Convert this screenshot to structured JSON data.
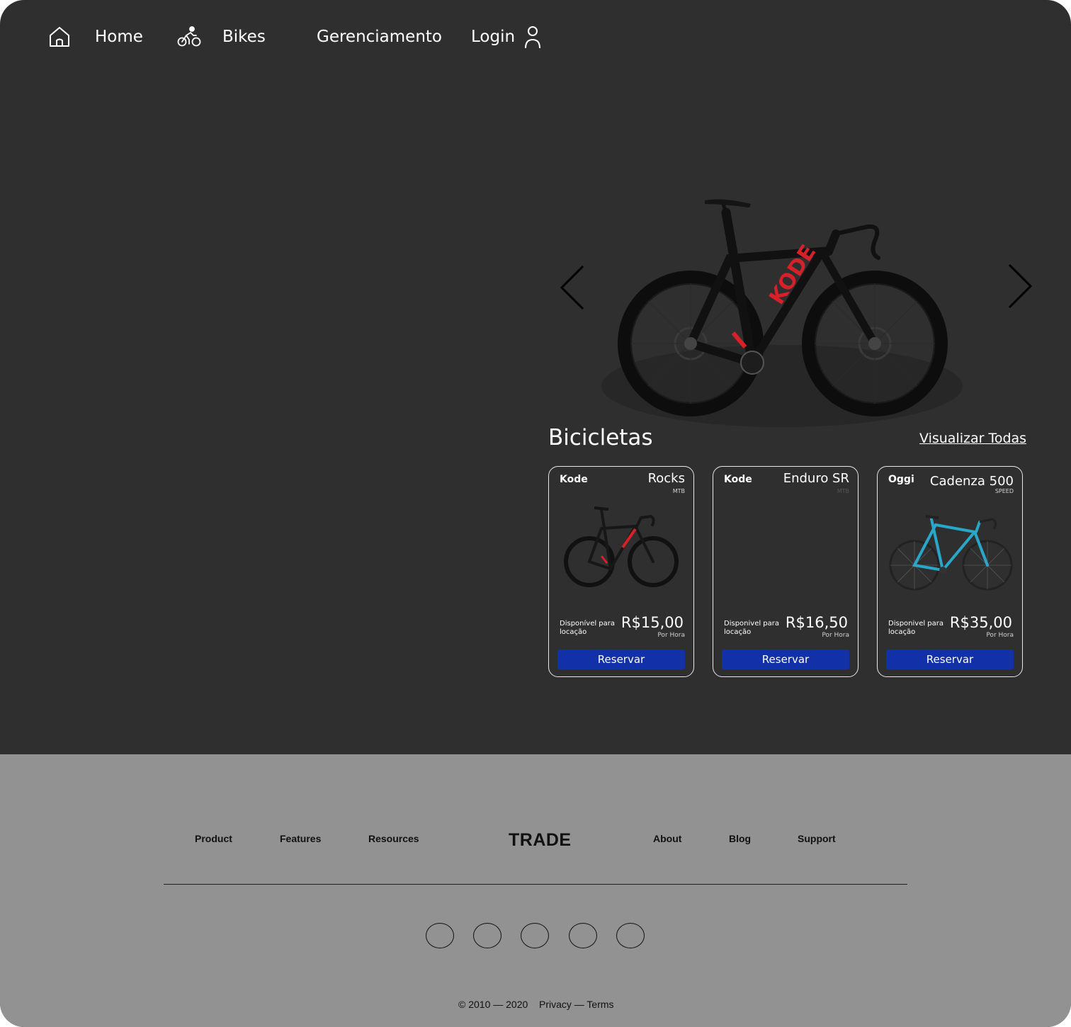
{
  "nav": {
    "home_label": "Home",
    "bikes_label": "Bikes",
    "manage_label": "Gerenciamento",
    "login_label": "Login",
    "icons": [
      "home-icon",
      "cyclist-icon",
      "user-icon"
    ]
  },
  "hero": {
    "bike_brand_text": "KODE",
    "accent_color": "#d6202a"
  },
  "section": {
    "title": "Bicicletas",
    "view_all": "Visualizar Todas"
  },
  "cards": [
    {
      "brand": "Kode",
      "model": "Rocks",
      "type": "MTB",
      "availability": "Disponível para locação",
      "price": "R$15,00",
      "per": "Por Hora",
      "button": "Reservar",
      "frame_color": "#1b1b1b"
    },
    {
      "brand": "Kode",
      "model": "Enduro SR",
      "type": "MTB",
      "availability": "Disponivel para locação",
      "price": "R$16,50",
      "per": "Por Hora",
      "button": "Reservar"
    },
    {
      "brand": "Oggi",
      "model": "Cadenza 500",
      "type": "SPEED",
      "availability": "Disponivel para locação",
      "price": "R$35,00",
      "per": "Por Hora",
      "button": "Reservar",
      "frame_color": "#29a7c9"
    }
  ],
  "footer": {
    "links_left": [
      "Product",
      "Features",
      "Resources"
    ],
    "logo": "TRADE",
    "links_right": [
      "About",
      "Blog",
      "Support"
    ],
    "copyright": "© 2010 — 2020",
    "legal": "Privacy — Terms"
  },
  "colors": {
    "background": "#2f2f2f",
    "footer": "#929292",
    "button": "#1230a8"
  }
}
